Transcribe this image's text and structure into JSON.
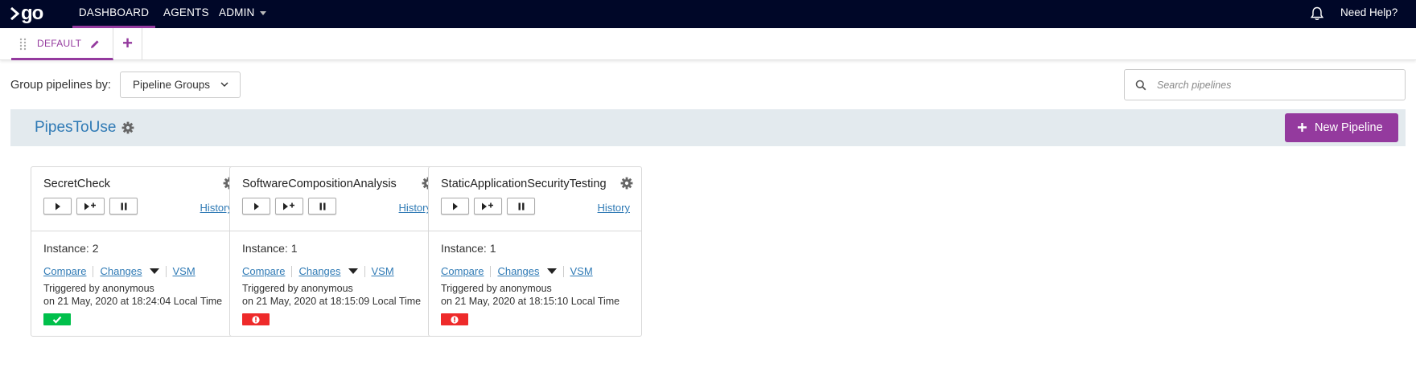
{
  "nav": {
    "logo_text": "go",
    "items": [
      "DASHBOARD",
      "AGENTS",
      "ADMIN"
    ],
    "need_help": "Need Help?"
  },
  "tabs": {
    "default_label": "DEFAULT",
    "add_label": "+"
  },
  "toolbar": {
    "group_by_label": "Group pipelines by:",
    "group_by_value": "Pipeline Groups",
    "search_placeholder": "Search pipelines"
  },
  "group": {
    "name": "PipesToUse",
    "new_pipeline_label": "New Pipeline"
  },
  "colors": {
    "accent": "#943a9e",
    "link": "#2f7ab5",
    "passed": "#00c04b",
    "failed": "#ee2a2a",
    "nav_bg": "#000728"
  },
  "pipelines": [
    {
      "name": "SecretCheck",
      "history": "History",
      "instance": "Instance: 2",
      "compare": "Compare",
      "changes": "Changes",
      "vsm": "VSM",
      "triggered_by": "Triggered by anonymous",
      "triggered_on": "on 21 May, 2020 at 18:24:04 Local Time",
      "stage_status": "passed",
      "stage_icon": "check-icon"
    },
    {
      "name": "SoftwareCompositionAnalysis",
      "history": "History",
      "instance": "Instance: 1",
      "compare": "Compare",
      "changes": "Changes",
      "vsm": "VSM",
      "triggered_by": "Triggered by anonymous",
      "triggered_on": "on 21 May, 2020 at 18:15:09 Local Time",
      "stage_status": "failed",
      "stage_icon": "exclamation-icon"
    },
    {
      "name": "StaticApplicationSecurityTesting",
      "history": "History",
      "instance": "Instance: 1",
      "compare": "Compare",
      "changes": "Changes",
      "vsm": "VSM",
      "triggered_by": "Triggered by anonymous",
      "triggered_on": "on 21 May, 2020 at 18:15:10 Local Time",
      "stage_status": "failed",
      "stage_icon": "exclamation-icon"
    }
  ]
}
